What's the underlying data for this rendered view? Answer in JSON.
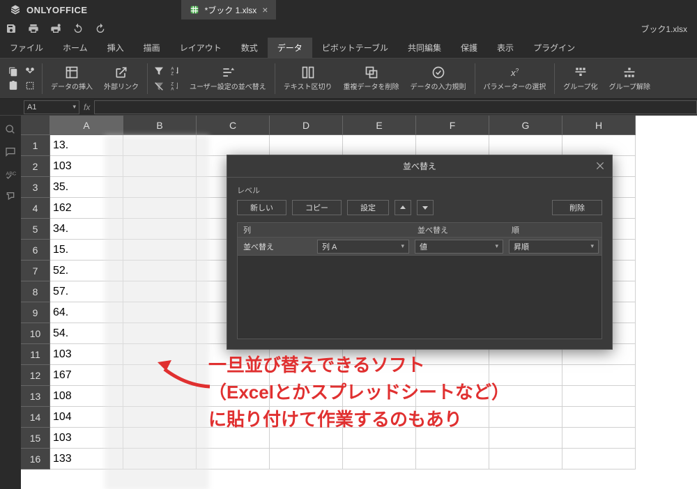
{
  "app": {
    "name": "ONLYOFFICE",
    "doc_tab_label": "*ブック 1.xlsx",
    "filename": "ブック1.xlsx"
  },
  "menu": {
    "items": [
      "ファイル",
      "ホーム",
      "挿入",
      "描画",
      "レイアウト",
      "数式",
      "データ",
      "ピボットテーブル",
      "共同編集",
      "保護",
      "表示",
      "プラグイン"
    ],
    "active_index": 6
  },
  "ribbon": {
    "insert_data": "データの挿入",
    "external_link": "外部リンク",
    "custom_sort": "ユーザー設定の並べ替え",
    "text_to_cols": "テキスト区切り",
    "remove_dup": "重複データを削除",
    "data_validation": "データの入力規則",
    "parameter_select": "パラメーターの選択",
    "group": "グループ化",
    "ungroup": "グループ解除"
  },
  "namebox": {
    "value": "A1"
  },
  "sheet": {
    "columns": [
      "A",
      "B",
      "C",
      "D",
      "E",
      "F",
      "G",
      "H"
    ],
    "selected_col": 0,
    "rows": [
      "1",
      "2",
      "3",
      "4",
      "5",
      "6",
      "7",
      "8",
      "9",
      "10",
      "11",
      "12",
      "13",
      "14",
      "15",
      "16"
    ],
    "colA_values": [
      "13.",
      "103",
      "35.",
      "162",
      "34.",
      "15.",
      "52.",
      "57.",
      "64.",
      "54.",
      "103",
      "167",
      "108",
      "104",
      "103",
      "133"
    ]
  },
  "dialog": {
    "title": "並べ替え",
    "section_label": "レベル",
    "btn_new": "新しい",
    "btn_copy": "コピー",
    "btn_settings": "設定",
    "btn_delete": "削除",
    "th_col": "列",
    "th_sort": "並べ替え",
    "th_order": "順",
    "row_label": "並べ替え",
    "sel_column": "列 A",
    "sel_sorton": "値",
    "sel_order": "昇順"
  },
  "annotation": {
    "line1": "一旦並び替えできるソフト",
    "line2": "（Excelとかスプレッドシートなど）",
    "line3": "に貼り付けて作業するのもあり"
  }
}
